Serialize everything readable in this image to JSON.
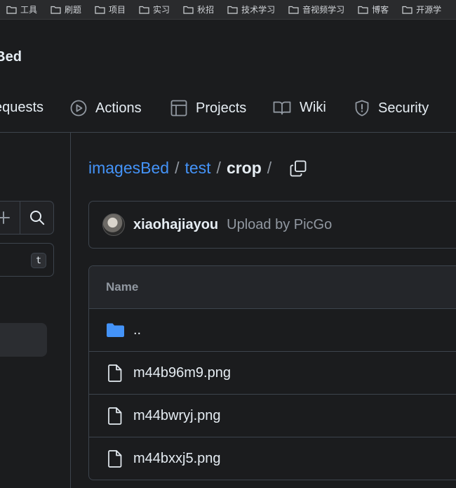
{
  "bookmarks": [
    {
      "label": "工具",
      "icon": "folder-icon"
    },
    {
      "label": "刷题",
      "icon": "folder-icon"
    },
    {
      "label": "项目",
      "icon": "folder-icon"
    },
    {
      "label": "实习",
      "icon": "folder-icon"
    },
    {
      "label": "秋招",
      "icon": "folder-icon"
    },
    {
      "label": "技术学习",
      "icon": "folder-icon"
    },
    {
      "label": "音视频学习",
      "icon": "folder-icon"
    },
    {
      "label": "博客",
      "icon": "folder-icon"
    },
    {
      "label": "开源学",
      "icon": "folder-icon"
    }
  ],
  "repo": {
    "name": "sBed"
  },
  "tabs": [
    {
      "label": "equests",
      "icon": "pull-request-icon"
    },
    {
      "label": "Actions",
      "icon": "play-icon"
    },
    {
      "label": "Projects",
      "icon": "table-icon"
    },
    {
      "label": "Wiki",
      "icon": "book-icon"
    },
    {
      "label": "Security",
      "icon": "shield-icon"
    }
  ],
  "sidebar": {
    "filter_shortcut": "t"
  },
  "breadcrumb": {
    "repo": "imagesBed",
    "folder": "test",
    "current": "crop",
    "separator": "/"
  },
  "commit": {
    "author": "xiaohajiayou",
    "message": "Upload by PicGo"
  },
  "file_table": {
    "header": "Name",
    "rows": [
      {
        "name": "..",
        "type": "folder",
        "icon": "folder-icon"
      },
      {
        "name": "m44b96m9.png",
        "type": "file",
        "icon": "file-icon"
      },
      {
        "name": "m44bwryj.png",
        "type": "file",
        "icon": "file-icon"
      },
      {
        "name": "m44bxxj5.png",
        "type": "file",
        "icon": "file-icon"
      }
    ]
  },
  "colors": {
    "background": "#1b1c1e",
    "link": "#4493f8",
    "folder": "#4493f8",
    "border": "#3d444d",
    "muted": "#9198a1"
  }
}
